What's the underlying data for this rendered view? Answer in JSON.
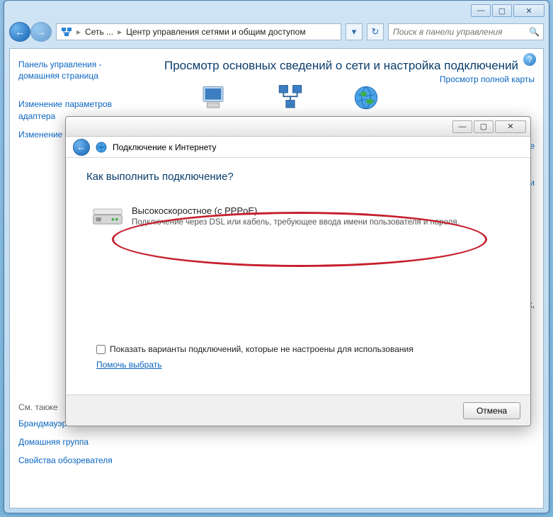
{
  "window": {
    "controls": {
      "min": "—",
      "max": "▢",
      "close": "✕"
    }
  },
  "toolbar": {
    "back_glyph": "←",
    "fwd_glyph": "→",
    "refresh_glyph": "↻",
    "search_placeholder": "Поиск в панели управления"
  },
  "breadcrumb": {
    "root_label": "Сеть ...",
    "page_label": "Центр управления сетями и общим доступом",
    "sep": "▸"
  },
  "sidebar": {
    "home_link": "Панель управления - домашняя страница",
    "links": [
      "Изменение параметров адаптера",
      "Изменение параметров"
    ],
    "see_also_heading": "См. также",
    "see_also": [
      "Брандмауэр Windows",
      "Домашняя группа",
      "Свойства обозревателя"
    ]
  },
  "main": {
    "heading": "Просмотр основных сведений о сети и настройка подключений",
    "view_map": "Просмотр полной карты",
    "net_items": [
      "DESKTOP",
      "Сеть",
      "Интернет"
    ],
    "truncated_link_1": "ключение",
    "truncated_link_2": "ние по сети",
    "truncated_text": "терах,"
  },
  "dialog": {
    "controls": {
      "min": "—",
      "max": "▢",
      "close": "✕"
    },
    "back_glyph": "←",
    "title": "Подключение к Интернету",
    "heading": "Как выполнить подключение?",
    "option_title": "Высокоскоростное (с PPPoE)",
    "option_desc": "Подключение через DSL или кабель, требующее ввода имени пользователя и пароля.",
    "checkbox_label": "Показать варианты подключений, которые не настроены для использования",
    "help_link": "Помочь выбрать",
    "cancel": "Отмена"
  }
}
